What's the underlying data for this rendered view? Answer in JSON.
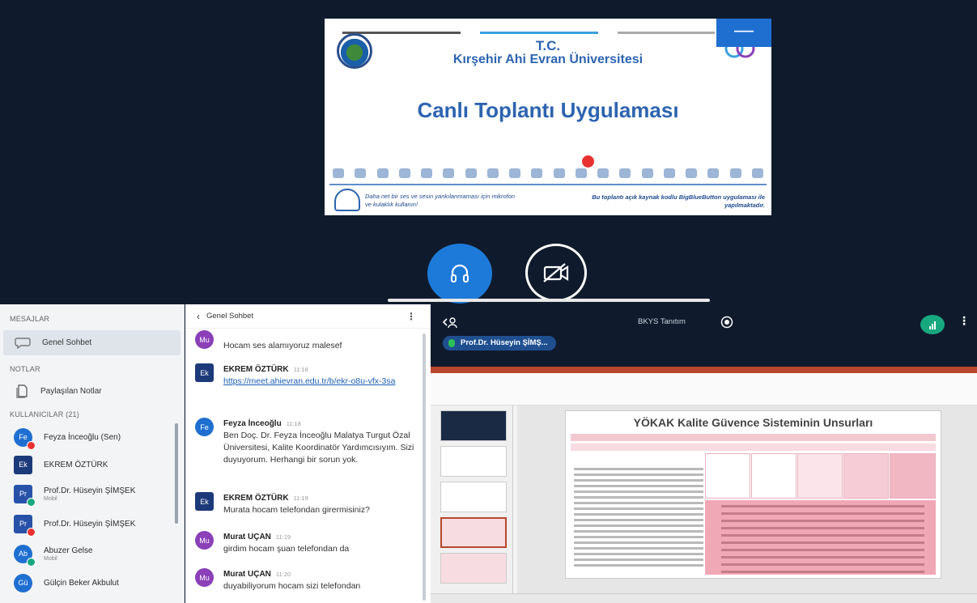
{
  "slide": {
    "tc": "T.C.",
    "university": "Kırşehir Ahi Evran Üniversitesi",
    "title": "Canlı Toplantı Uygulaması",
    "note_left": "Daha net bir ses ve sesin yankılanmaması için mikrofon ve kulaklık kullanın!",
    "note_right": "Bu toplantı açık kaynak kodlu BigBlueButton uygulaması ile yapılmaktadır.",
    "minimize_symbol": "—"
  },
  "sidebar": {
    "messages_header": "MESAJLAR",
    "public_chat": "Genel Sohbet",
    "notes_header": "NOTLAR",
    "shared_notes": "Paylaşılan Notlar",
    "users_header": "KULLANICILAR (21)",
    "users": [
      {
        "initials": "Fe",
        "name": "Feyza İnceoğlu (Sen)",
        "sub": "",
        "color": "#1f6fd1",
        "badge": "#e83232"
      },
      {
        "initials": "Ek",
        "name": "EKREM ÖZTÜRK",
        "sub": "",
        "color": "#1c3a7a",
        "badge": ""
      },
      {
        "initials": "Pr",
        "name": "Prof.Dr. Hüseyin ŞİMŞEK",
        "sub": "Mobil",
        "color": "#2852a8",
        "badge": "#18a880"
      },
      {
        "initials": "Pr",
        "name": "Prof.Dr. Hüseyin ŞİMŞEK",
        "sub": "",
        "color": "#2852a8",
        "badge": "#e83232"
      },
      {
        "initials": "Ab",
        "name": "Abuzer Gelse",
        "sub": "Mobil",
        "color": "#1f6fd1",
        "badge": "#18a880"
      },
      {
        "initials": "Gü",
        "name": "Gülçin Beker Akbulut",
        "sub": "",
        "color": "#1f6fd1",
        "badge": ""
      }
    ]
  },
  "chat": {
    "header": "Genel Sohbet",
    "back_symbol": "‹",
    "menu_symbol": "⋮",
    "messages": [
      {
        "initials": "Mu",
        "author": "",
        "time": "",
        "text": "Hocam ses alamıyoruz malesef",
        "color": "#8b3fb8"
      },
      {
        "initials": "Ek",
        "author": "EKREM ÖZTÜRK",
        "time": "11:18",
        "text": "https://meet.ahievran.edu.tr/b/ekr-o8u-vfx-3sa",
        "color": "#1c3a7a"
      },
      {
        "initials": "Fe",
        "author": "Feyza İnceoğlu",
        "time": "11:18",
        "text": "Ben Doç. Dr. Feyza İnceoğlu Malatya Turgut Özal Üniversitesi, Kalite Koordinatör Yardımcısıyım. Sizi duyuyorum. Herhangi bir sorun yok.",
        "color": "#1f6fd1"
      },
      {
        "initials": "Ek",
        "author": "EKREM ÖZTÜRK",
        "time": "11:19",
        "text": "Murata hocam telefondan girermisiniz?",
        "color": "#1c3a7a"
      },
      {
        "initials": "Mu",
        "author": "Murat UÇAN",
        "time": "11:19",
        "text": "girdim hocam şuan telefondan da",
        "color": "#8b3fb8"
      },
      {
        "initials": "Mu",
        "author": "Murat UÇAN",
        "time": "11:20",
        "text": "duyabiliyorum hocam sizi telefondan",
        "color": "#8b3fb8"
      }
    ]
  },
  "share": {
    "title": "BKYS Tanıtım",
    "presenter": "Prof.Dr. Hüseyin ŞİMŞ...",
    "menu_symbol": "⋮",
    "slide_title": "YÖKAK Kalite Güvence Sisteminin Unsurları"
  }
}
